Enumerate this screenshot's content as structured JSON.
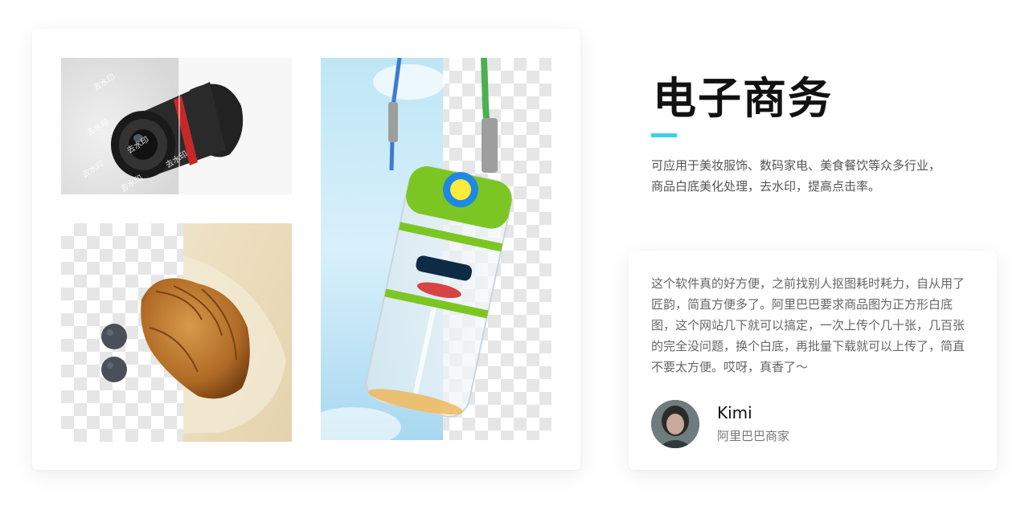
{
  "header": {
    "title": "电子商务",
    "description": "可应用于美妆服饰、数码家电、美食餐饮等众多行业，商品白底美化处理，去水印，提高点击率。"
  },
  "showcase": {
    "watermark_text": "去水印",
    "images": [
      "camera-lens-photo",
      "croissant-photo",
      "water-bottle-photo"
    ]
  },
  "testimonial": {
    "quote": "这个软件真的好方便，之前找别人抠图耗时耗力，自从用了匠韵，简直方便多了。阿里巴巴要求商品图为正方形白底图，这个网站几下就可以搞定，一次上传个几十张，几百张的完全没问题，换个白底，再批量下载就可以上传了，简直不要太方便。哎呀，真香了～",
    "author_name": "Kimi",
    "author_role": "阿里巴巴商家"
  },
  "colors": {
    "accent": "#3ad0ee",
    "title": "#111111",
    "body_text": "#666666"
  }
}
